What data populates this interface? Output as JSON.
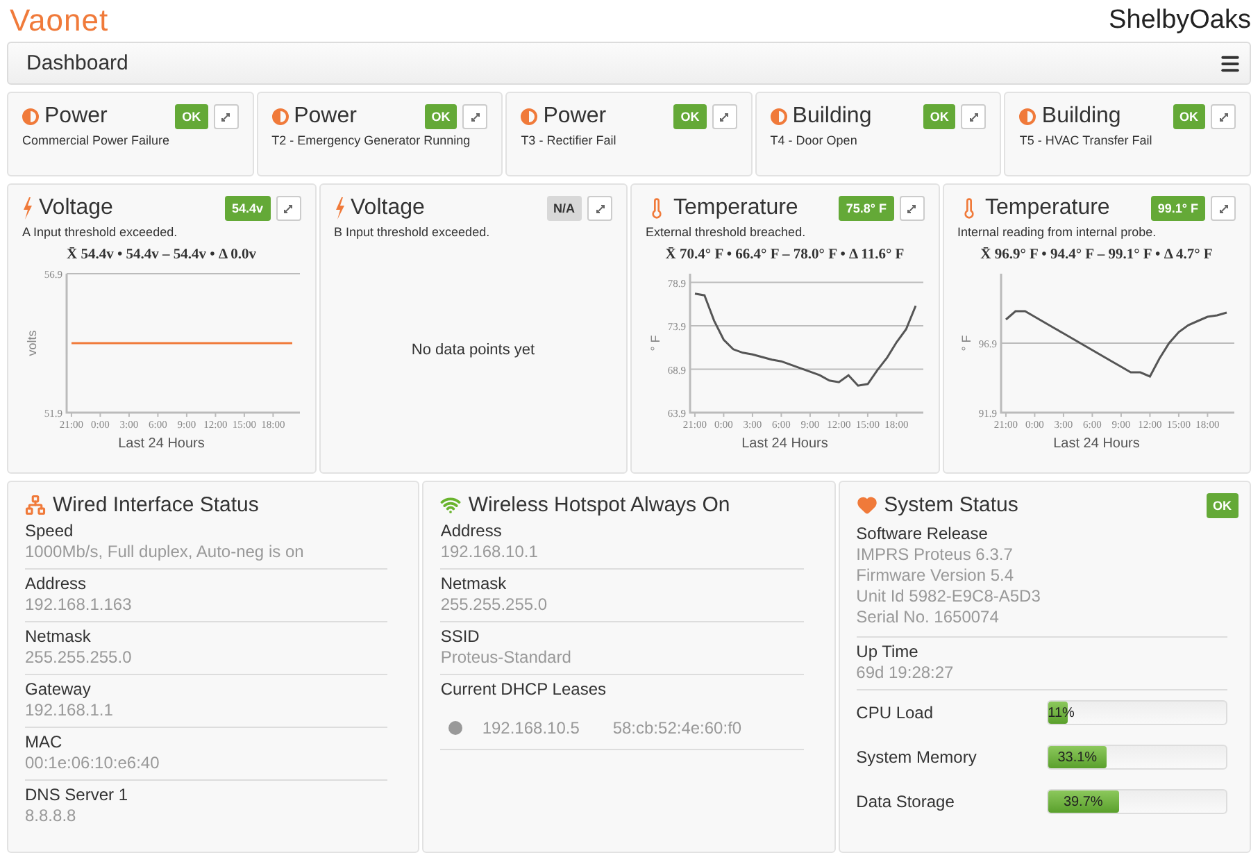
{
  "header": {
    "logo": "Vaonet",
    "site": "ShelbyOaks"
  },
  "nav": {
    "title": "Dashboard"
  },
  "alarms": [
    {
      "category": "Power",
      "description": "Commercial Power Failure",
      "badge": {
        "text": "OK",
        "color": "#64a937"
      }
    },
    {
      "category": "Power",
      "description": "T2 - Emergency Generator Running",
      "badge": {
        "text": "OK",
        "color": "#64a937"
      }
    },
    {
      "category": "Power",
      "description": "T3 - Rectifier Fail",
      "badge": {
        "text": "OK",
        "color": "#64a937"
      }
    },
    {
      "category": "Building",
      "description": "T4 - Door Open",
      "badge": {
        "text": "OK",
        "color": "#64a937"
      }
    },
    {
      "category": "Building",
      "description": "T5 - HVAC Transfer Fail",
      "badge": {
        "text": "OK",
        "color": "#64a937"
      }
    }
  ],
  "sensors": [
    {
      "kind": "voltage",
      "title": "Voltage",
      "description": "A Input threshold exceeded.",
      "badge": {
        "text": "54.4v",
        "color": "#64a937"
      },
      "chart_data": {
        "type": "line",
        "title": "X̄ 54.4v • 54.4v – 54.4v • Δ 0.0v",
        "xlabel": "Last 24 Hours",
        "ylabel": "volts",
        "categories": [
          "21:00",
          null,
          null,
          "0:00",
          null,
          null,
          "3:00",
          null,
          null,
          "6:00",
          null,
          null,
          "9:00",
          null,
          null,
          "12:00",
          null,
          null,
          "15:00",
          null,
          null,
          "18:00",
          null,
          null
        ],
        "series": [
          {
            "color": "#f07a3a",
            "values": [
              54.4,
              54.4,
              54.4,
              54.4,
              54.4,
              54.4,
              54.4,
              54.4,
              54.4,
              54.4,
              54.4,
              54.4,
              54.4,
              54.4,
              54.4,
              54.4,
              54.4,
              54.4,
              54.4,
              54.4,
              54.4,
              54.4,
              54.4,
              54.4
            ]
          }
        ],
        "ylim": [
          51.9,
          56.9
        ],
        "yticks": [
          51.9,
          56.9
        ],
        "grid": true
      }
    },
    {
      "kind": "voltage",
      "title": "Voltage",
      "description": "B Input threshold exceeded.",
      "badge": {
        "text": "N/A",
        "color": "#d8d8d8"
      },
      "empty_text": "No data points yet"
    },
    {
      "kind": "temperature",
      "title": "Temperature",
      "description": "External threshold breached.",
      "badge": {
        "text": "75.8° F",
        "color": "#64a937"
      },
      "chart_data": {
        "type": "line",
        "title": "X̄ 70.4° F • 66.4° F – 78.0° F • Δ 11.6° F",
        "xlabel": "Last 24 Hours",
        "ylabel": "° F",
        "categories": [
          "21:00",
          null,
          null,
          "0:00",
          null,
          null,
          "3:00",
          null,
          null,
          "6:00",
          null,
          null,
          "9:00",
          null,
          null,
          "12:00",
          null,
          null,
          "15:00",
          null,
          null,
          "18:00",
          null,
          null
        ],
        "series": [
          {
            "color": "#555555",
            "values": [
              77.6,
              77.4,
              74.5,
              72.3,
              71.2,
              70.8,
              70.6,
              70.3,
              70.0,
              69.8,
              69.4,
              69.0,
              68.6,
              68.2,
              67.6,
              67.4,
              68.2,
              67.0,
              67.2,
              68.8,
              70.2,
              72.0,
              73.5,
              76.2
            ]
          }
        ],
        "ylim": [
          63.9,
          79.9
        ],
        "yticks": [
          63.9,
          68.9,
          73.9,
          78.9
        ],
        "grid": true
      }
    },
    {
      "kind": "temperature",
      "title": "Temperature",
      "description": "Internal reading from internal probe.",
      "badge": {
        "text": "99.1° F",
        "color": "#64a937"
      },
      "chart_data": {
        "type": "line",
        "title": "X̄ 96.9° F • 94.4° F – 99.1° F • Δ 4.7° F",
        "xlabel": "Last 24 Hours",
        "ylabel": "° F",
        "categories": [
          "21:00",
          null,
          null,
          "0:00",
          null,
          null,
          "3:00",
          null,
          null,
          "6:00",
          null,
          null,
          "9:00",
          null,
          null,
          "12:00",
          null,
          null,
          "15:00",
          null,
          null,
          "18:00",
          null,
          null
        ],
        "series": [
          {
            "color": "#555555",
            "values": [
              98.6,
              99.2,
              99.2,
              98.8,
              98.4,
              98.0,
              97.6,
              97.2,
              96.8,
              96.4,
              96.0,
              95.6,
              95.2,
              94.8,
              94.8,
              94.5,
              95.8,
              96.9,
              97.7,
              98.2,
              98.5,
              98.8,
              98.9,
              99.1
            ]
          }
        ],
        "ylim": [
          91.9,
          101.9
        ],
        "yticks": [
          91.9,
          96.9
        ],
        "grid": true
      }
    }
  ],
  "wired": {
    "title": "Wired Interface Status",
    "fields": [
      {
        "label": "Speed",
        "value": "1000Mb/s, Full duplex, Auto-neg is on"
      },
      {
        "label": "Address",
        "value": "192.168.1.163"
      },
      {
        "label": "Netmask",
        "value": "255.255.255.0"
      },
      {
        "label": "Gateway",
        "value": "192.168.1.1"
      },
      {
        "label": "MAC",
        "value": "00:1e:06:10:e6:40"
      },
      {
        "label": "DNS Server 1",
        "value": "8.8.8.8"
      }
    ]
  },
  "wireless": {
    "title": "Wireless Hotspot Always On",
    "fields": [
      {
        "label": "Address",
        "value": "192.168.10.1"
      },
      {
        "label": "Netmask",
        "value": "255.255.255.0"
      },
      {
        "label": "SSID",
        "value": "Proteus-Standard"
      }
    ],
    "leases_label": "Current DHCP Leases",
    "leases": [
      {
        "ip": "192.168.10.5",
        "mac": "58:cb:52:4e:60:f0"
      }
    ]
  },
  "system": {
    "title": "System Status",
    "badge": {
      "text": "OK",
      "color": "#64a937"
    },
    "software": {
      "label": "Software Release",
      "lines": [
        "IMPRS Proteus 6.3.7",
        "Firmware Version 5.4",
        "Unit Id 5982-E9C8-A5D3",
        "Serial No. 1650074"
      ]
    },
    "uptime": {
      "label": "Up Time",
      "value": "69d 19:28:27"
    },
    "meters": [
      {
        "label": "CPU Load",
        "level": 0.11,
        "reading": "11%"
      },
      {
        "label": "System Memory",
        "level": 0.331,
        "reading": "33.1%"
      },
      {
        "label": "Data Storage",
        "level": 0.397,
        "reading": "39.7%"
      }
    ]
  }
}
